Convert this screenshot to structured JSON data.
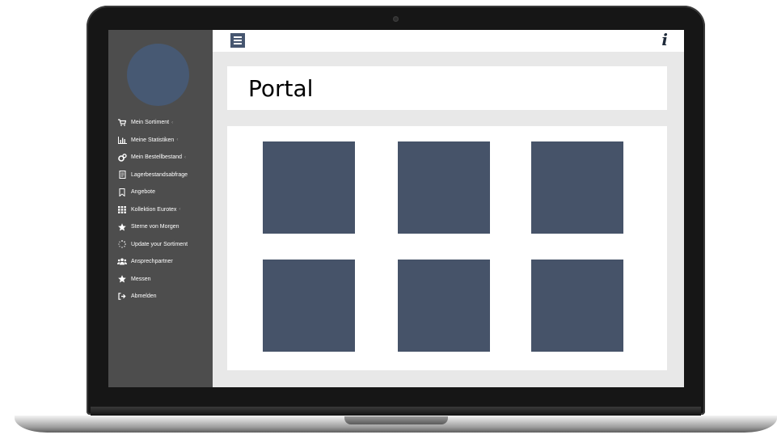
{
  "app": {
    "page_title": "Portal",
    "info_glyph": "i"
  },
  "sidebar": {
    "items": [
      {
        "label": "Mein Sortiment",
        "icon": "cart-icon",
        "has_submenu": true
      },
      {
        "label": "Meine Statistiken",
        "icon": "bar-chart-icon",
        "has_submenu": true
      },
      {
        "label": "Mein Bestellbestand",
        "icon": "cogs-icon",
        "has_submenu": true
      },
      {
        "label": "Lagerbestandsabfrage",
        "icon": "document-icon",
        "has_submenu": false
      },
      {
        "label": "Angebote",
        "icon": "bookmark-icon",
        "has_submenu": false
      },
      {
        "label": "Kollektion Eurotex",
        "icon": "grid-icon",
        "has_submenu": true
      },
      {
        "label": "Sterne von Morgen",
        "icon": "star-icon",
        "has_submenu": false
      },
      {
        "label": "Update your Sortiment",
        "icon": "spinner-icon",
        "has_submenu": false
      },
      {
        "label": "Ansprechpartner",
        "icon": "users-icon",
        "has_submenu": false
      },
      {
        "label": "Messen",
        "icon": "star-icon",
        "has_submenu": false
      },
      {
        "label": "Abmelden",
        "icon": "sign-out-icon",
        "has_submenu": false
      }
    ],
    "submenu_glyph": "‹"
  },
  "tiles": {
    "count": 6,
    "color": "#465369"
  },
  "colors": {
    "sidebar_bg": "#4d4d4d",
    "avatar": "#475973",
    "accent": "#465670",
    "content_bg": "#e8e8e8"
  }
}
